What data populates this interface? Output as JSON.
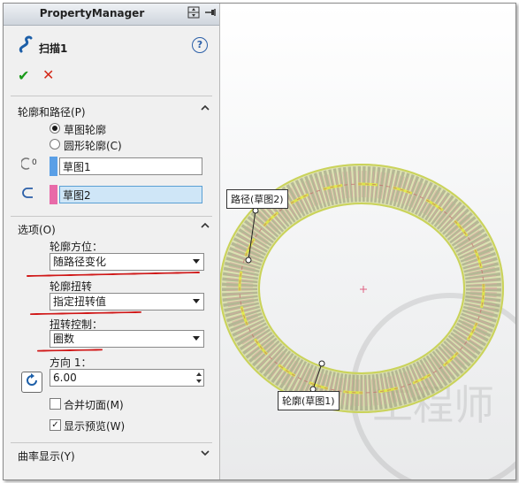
{
  "panel": {
    "title": "PropertyManager",
    "header_icons": [
      "split-view-icon",
      "pin-icon"
    ],
    "feature_name": "扫描1",
    "help_icon": "help-icon",
    "ok_icon": "✔",
    "cancel_icon": "✕"
  },
  "profile_path": {
    "heading": "轮廓和路径(P)",
    "radio_sketch_profile": "草图轮廓",
    "radio_circular_profile": "圆形轮廓(C)",
    "profile_value": "草图1",
    "path_value": "草图2",
    "profile_color": "#5a9fe6",
    "path_color": "#e86aa8"
  },
  "options": {
    "heading": "选项(O)",
    "orientation_label": "轮廓方位：",
    "orientation_value": "随路径变化",
    "twist_label": "轮廓扭转",
    "twist_value": "指定扭转值",
    "twist_control_label": "扭转控制：",
    "twist_control_value": "圈数",
    "direction_label": "方向 1：",
    "direction_value": "6.00",
    "merge_faces": "合并切面(M)",
    "show_preview": "显示预览(W)"
  },
  "curvature": {
    "heading": "曲率显示(Y)"
  },
  "viewport": {
    "path_callout": "路径(草图2)",
    "profile_callout": "轮廓(草图1)",
    "watermark": "工程师",
    "accent_red": "#d01818"
  }
}
